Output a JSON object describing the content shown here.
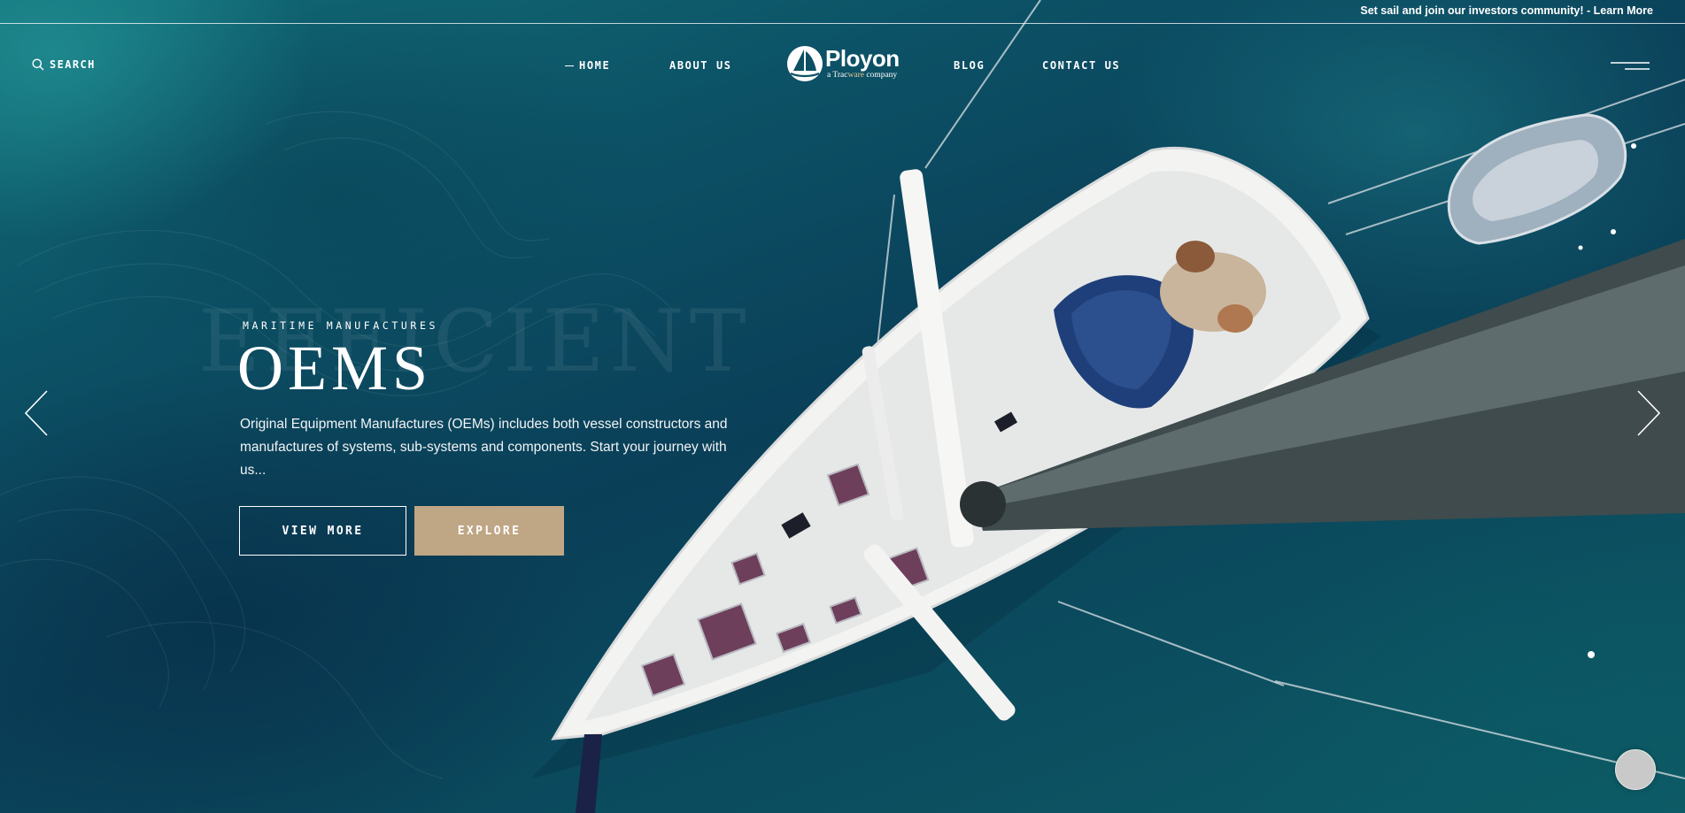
{
  "announcement": {
    "text": "Set sail and join our investors community! - Learn More"
  },
  "header": {
    "search_label": "SEARCH",
    "nav": [
      {
        "label": "HOME",
        "active": true
      },
      {
        "label": "ABOUT US"
      },
      {
        "label": "BLOG"
      },
      {
        "label": "CONTACT US"
      }
    ],
    "logo": {
      "name": "Ployon",
      "tagline_prefix": "a ",
      "tagline_brand_1": "Trac",
      "tagline_brand_2": "ware",
      "tagline_suffix": " company"
    },
    "menu_icon": "hamburger-icon"
  },
  "hero": {
    "ghost_word": "EFFICIENT",
    "eyebrow": "MARITIME MANUFACTURES",
    "title": "OEMS",
    "description": "Original Equipment Manufactures (OEMs) includes both vessel constructors and manufactures of systems, sub-systems and components. Start your journey with us...",
    "buttons": {
      "view_more": "VIEW MORE",
      "explore": "EXPLORE"
    },
    "prev_icon": "chevron-left-icon",
    "next_icon": "chevron-right-icon"
  },
  "colors": {
    "accent": "#bfa684",
    "logo_accent": "#e3c896",
    "sea": "#0b4a5c"
  },
  "scroll_top_icon": "scroll-to-top-icon"
}
